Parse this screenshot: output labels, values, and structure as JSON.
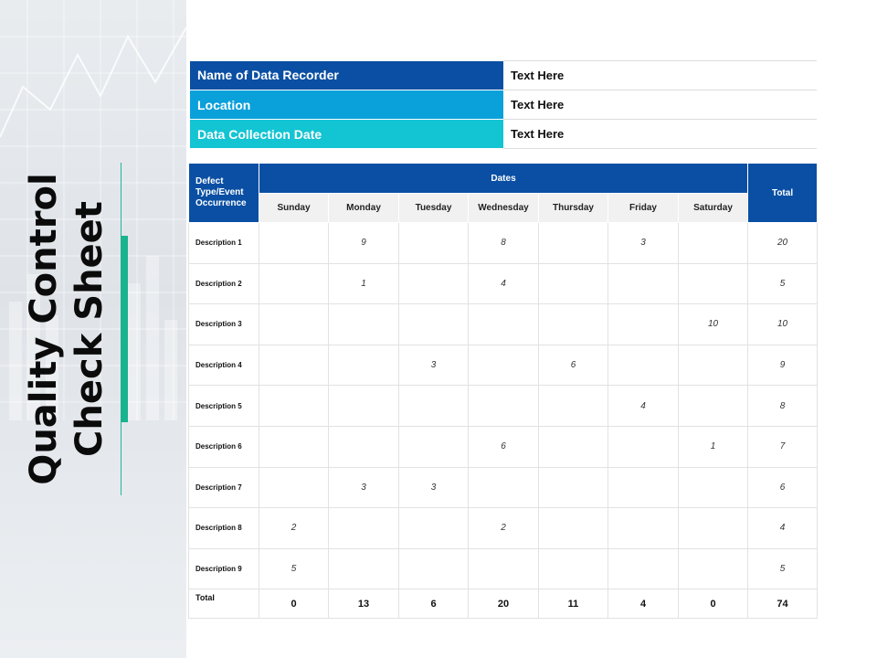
{
  "title": {
    "line1": "Quality Control",
    "line2": "Check Sheet"
  },
  "info": [
    {
      "label": "Name of Data Recorder",
      "value": "Text Here",
      "color": "#0a4fa3"
    },
    {
      "label": "Location",
      "value": "Text Here",
      "color": "#0aa0da"
    },
    {
      "label": "Data Collection  Date",
      "value": "Text Here",
      "color": "#13c4d3"
    }
  ],
  "table": {
    "defect_header": [
      "Defect",
      "Type/Event",
      "Occurrence"
    ],
    "dates_header": "Dates",
    "total_header": "Total",
    "days": [
      "Sunday",
      "Monday",
      "Tuesday",
      "Wednesday",
      "Thursday",
      "Friday",
      "Saturday"
    ],
    "rows": [
      {
        "label": "Description 1",
        "cells": [
          "",
          "9",
          "",
          "8",
          "",
          "3",
          ""
        ],
        "total": "20"
      },
      {
        "label": "Description 2",
        "cells": [
          "",
          "1",
          "",
          "4",
          "",
          "",
          ""
        ],
        "total": "5"
      },
      {
        "label": "Description 3",
        "cells": [
          "",
          "",
          "",
          "",
          "",
          "",
          "10"
        ],
        "total": "10"
      },
      {
        "label": "Description 4",
        "cells": [
          "",
          "",
          "3",
          "",
          "6",
          "",
          ""
        ],
        "total": "9"
      },
      {
        "label": "Description 5",
        "cells": [
          "",
          "",
          "",
          "",
          "",
          "4",
          ""
        ],
        "total": "8"
      },
      {
        "label": "Description 6",
        "cells": [
          "",
          "",
          "",
          "6",
          "",
          "",
          "1"
        ],
        "total": "7"
      },
      {
        "label": "Description 7",
        "cells": [
          "",
          "3",
          "3",
          "",
          "",
          "",
          ""
        ],
        "total": "6"
      },
      {
        "label": "Description 8",
        "cells": [
          "2",
          "",
          "",
          "2",
          "",
          "",
          ""
        ],
        "total": "4"
      },
      {
        "label": "Description 9",
        "cells": [
          "5",
          "",
          "",
          "",
          "",
          "",
          ""
        ],
        "total": "5"
      }
    ],
    "total_row": {
      "label": "Total",
      "cells": [
        "0",
        "13",
        "6",
        "20",
        "11",
        "4",
        "0"
      ],
      "total": "74"
    }
  },
  "colors": {
    "header_blue": "#0a4fa3",
    "accent_green": "#19b38f"
  }
}
